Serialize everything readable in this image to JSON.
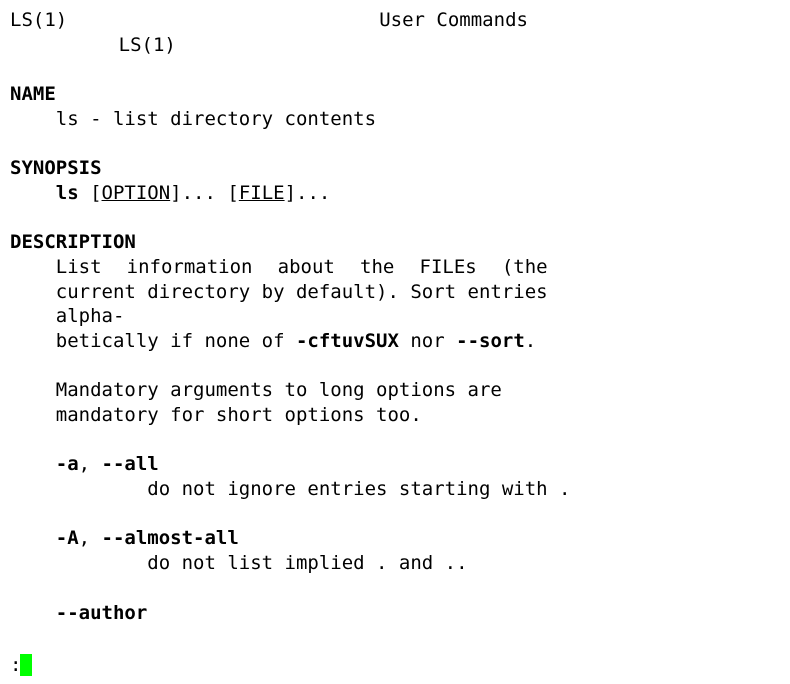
{
  "header": {
    "left": "LS(1)",
    "center": "User Commands",
    "right": "LS(1)"
  },
  "sections": {
    "name_heading": "NAME",
    "name_body": "ls - list directory contents",
    "synopsis_heading": "SYNOPSIS",
    "synopsis": {
      "cmd": "ls",
      "open1": " [",
      "arg1": "OPTION",
      "mid": "]... [",
      "arg2": "FILE",
      "close2": "]..."
    },
    "description_heading": "DESCRIPTION",
    "description": {
      "p1_a": "List information about the FILEs (the current directory by default).  Sort  entries  alpha‐",
      "p1_b": "betically if none of ",
      "p1_flags1": "-cftuvSUX",
      "p1_c": " nor ",
      "p1_flags2": "--sort",
      "p1_d": ".",
      "p2_a": "Mandatory   arguments  to  long  options  are",
      "p2_b": "mandatory for short options too."
    },
    "options": {
      "opt_a_short": "-a",
      "opt_a_sep": ", ",
      "opt_a_long": "--all",
      "opt_a_desc": "do not ignore entries starting with  .",
      "opt_A_short": "-A",
      "opt_A_sep": ", ",
      "opt_A_long": "--almost-all",
      "opt_A_desc": "do not list implied . and ..",
      "opt_author_long": "--author"
    }
  },
  "prompt": ":"
}
